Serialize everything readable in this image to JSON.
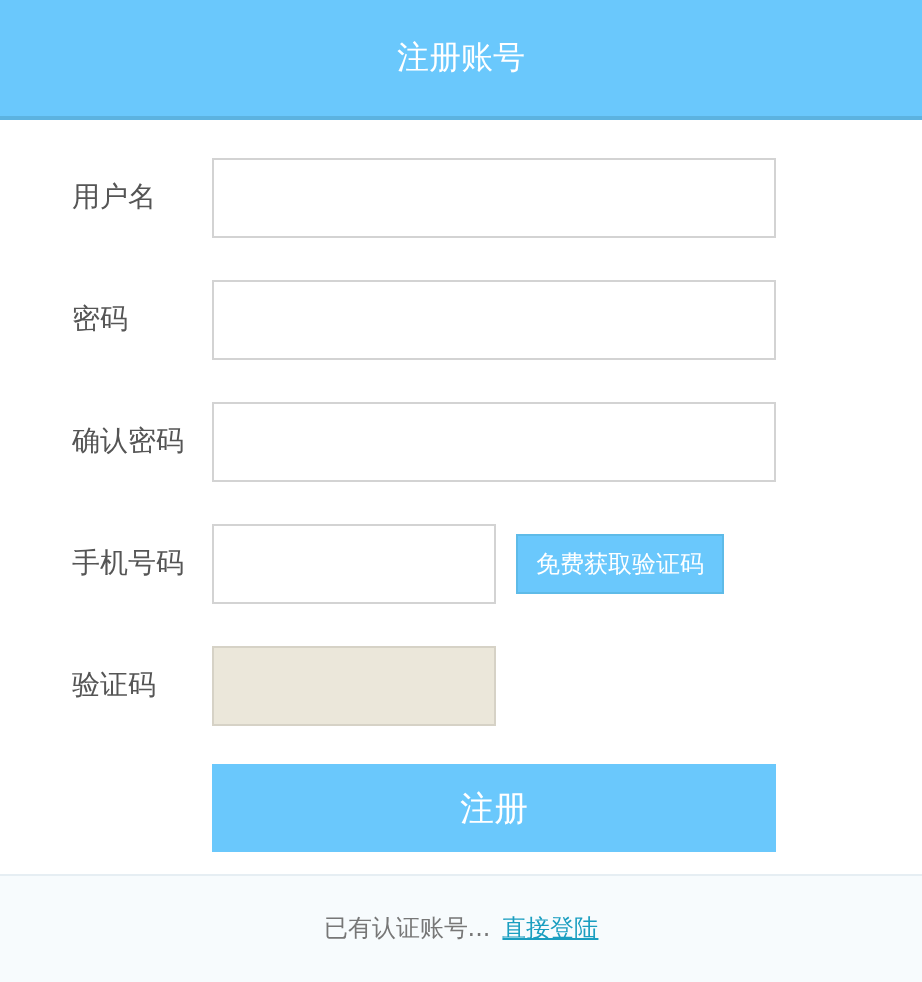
{
  "header": {
    "title": "注册账号"
  },
  "fields": [
    {
      "label": "用户名",
      "kind": "wide",
      "disabled": false
    },
    {
      "label": "密码",
      "kind": "wide",
      "disabled": false
    },
    {
      "label": "确认密码",
      "kind": "wide",
      "disabled": false
    },
    {
      "label": "手机号码",
      "kind": "with-button",
      "disabled": false,
      "button": "免费获取验证码"
    },
    {
      "label": "验证码",
      "kind": "short",
      "disabled": true
    }
  ],
  "submit": "注册",
  "footer": {
    "text": "已有认证账号...",
    "link": "直接登陆"
  }
}
